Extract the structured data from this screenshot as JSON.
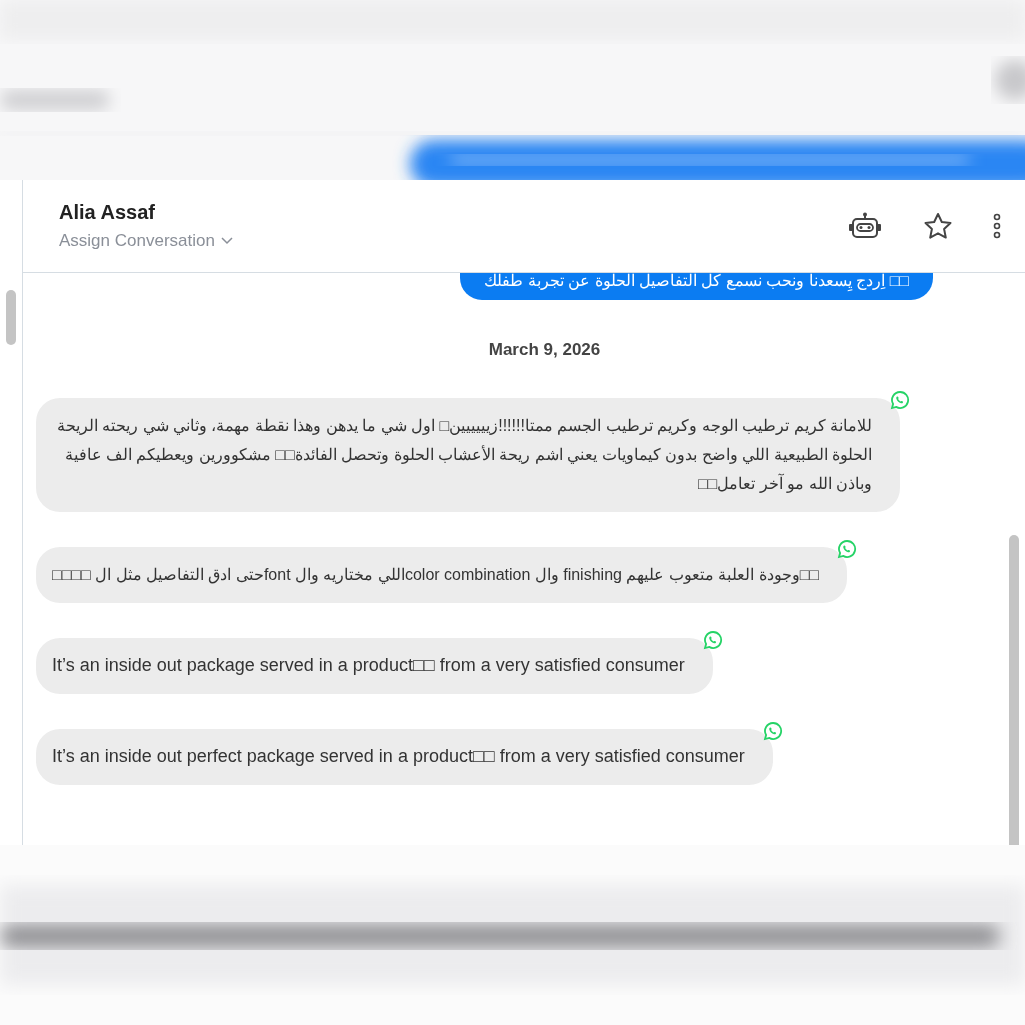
{
  "header": {
    "name": "Alia Assaf",
    "assign_label": "Assign Conversation"
  },
  "outgoing": {
    "text": "□□ اِردج يِسعدنا ونحب نسمع كل التفاصيل الحلوة عن تجربة طفلك",
    "right_to_left": true
  },
  "date_divider": "March 9, 2026",
  "messages": [
    {
      "text": "للامانة كريم ترطيب الوجه وكريم ترطيب الجسم ممتا!!!!!!زيييييين□ اول شي ما يدهن وهذا نقطة مهمة، وثاني شي ريحته الريحة الحلوة الطبيعية اللي واضح بدون كيماويات يعني اشم ريحة الأعشاب الحلوة وتحصل الفائدة□□ مشكوورين ويعطيكم الف عافية وباذن الله مو آخر تعامل□□",
      "right_to_left": true
    },
    {
      "text": "□□وجودة العلبة متعوب عليهم finishing وال color combinationاللي مختاريه وال fontحتى ادق التفاصيل مثل ال □□□□",
      "right_to_left": true
    },
    {
      "text": "It’s an inside out package served in a product□□ from a very satisfied consumer",
      "right_to_left": false
    },
    {
      "text": "It’s an inside out perfect package served in a product□□ from a very satisfied consumer",
      "right_to_left": false
    }
  ]
}
